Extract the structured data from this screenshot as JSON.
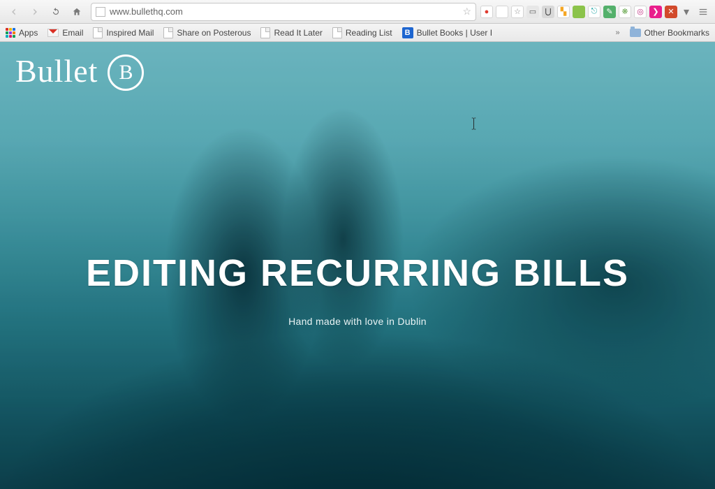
{
  "browser": {
    "url": "www.bullethq.com",
    "nav_drop": "▾",
    "extensions": [
      {
        "name": "ext-red-dot",
        "bg": "#ffffff",
        "glyph": "●",
        "fg": "#e03b2f"
      },
      {
        "name": "ext-doc",
        "bg": "#ffffff",
        "glyph": "",
        "fg": "#888"
      },
      {
        "name": "ext-star",
        "bg": "#ffffff",
        "glyph": "☆",
        "fg": "#888"
      },
      {
        "name": "ext-rect",
        "bg": "#e7e7e7",
        "glyph": "▭",
        "fg": "#555"
      },
      {
        "name": "ext-u",
        "bg": "#d8d8d8",
        "glyph": "⋃",
        "fg": "#333"
      },
      {
        "name": "ext-palette",
        "bg": "#ffffff",
        "glyph": "▚",
        "fg": "#f5a623"
      },
      {
        "name": "ext-green",
        "bg": "#8bc34a",
        "glyph": "",
        "fg": "#fff"
      },
      {
        "name": "ext-teal",
        "bg": "#ffffff",
        "glyph": "⎋",
        "fg": "#1aa3a3"
      },
      {
        "name": "ext-note",
        "bg": "#54b06b",
        "glyph": "✎",
        "fg": "#fff"
      },
      {
        "name": "ext-evernote",
        "bg": "#ffffff",
        "glyph": "❋",
        "fg": "#6aa84f"
      },
      {
        "name": "ext-instagram",
        "bg": "#ffffff",
        "glyph": "◎",
        "fg": "#c13584"
      },
      {
        "name": "ext-pink",
        "bg": "#e91e8c",
        "glyph": "❯",
        "fg": "#fff"
      },
      {
        "name": "ext-tools",
        "bg": "#d24a2b",
        "glyph": "✕",
        "fg": "#fff"
      }
    ]
  },
  "bookmarks": {
    "apps": "Apps",
    "items": [
      {
        "icon": "gmail",
        "label": "Email"
      },
      {
        "icon": "doc",
        "label": "Inspired Mail"
      },
      {
        "icon": "doc",
        "label": "Share on Posterous"
      },
      {
        "icon": "doc",
        "label": "Read It Later"
      },
      {
        "icon": "doc",
        "label": "Reading List"
      },
      {
        "icon": "bb",
        "label": "Bullet Books | User I"
      }
    ],
    "overflow": "»",
    "other": "Other Bookmarks"
  },
  "page": {
    "logo_text": "Bullet",
    "logo_badge": "B",
    "headline": "EDITING RECURRING BILLS",
    "tagline": "Hand made with love in Dublin"
  }
}
